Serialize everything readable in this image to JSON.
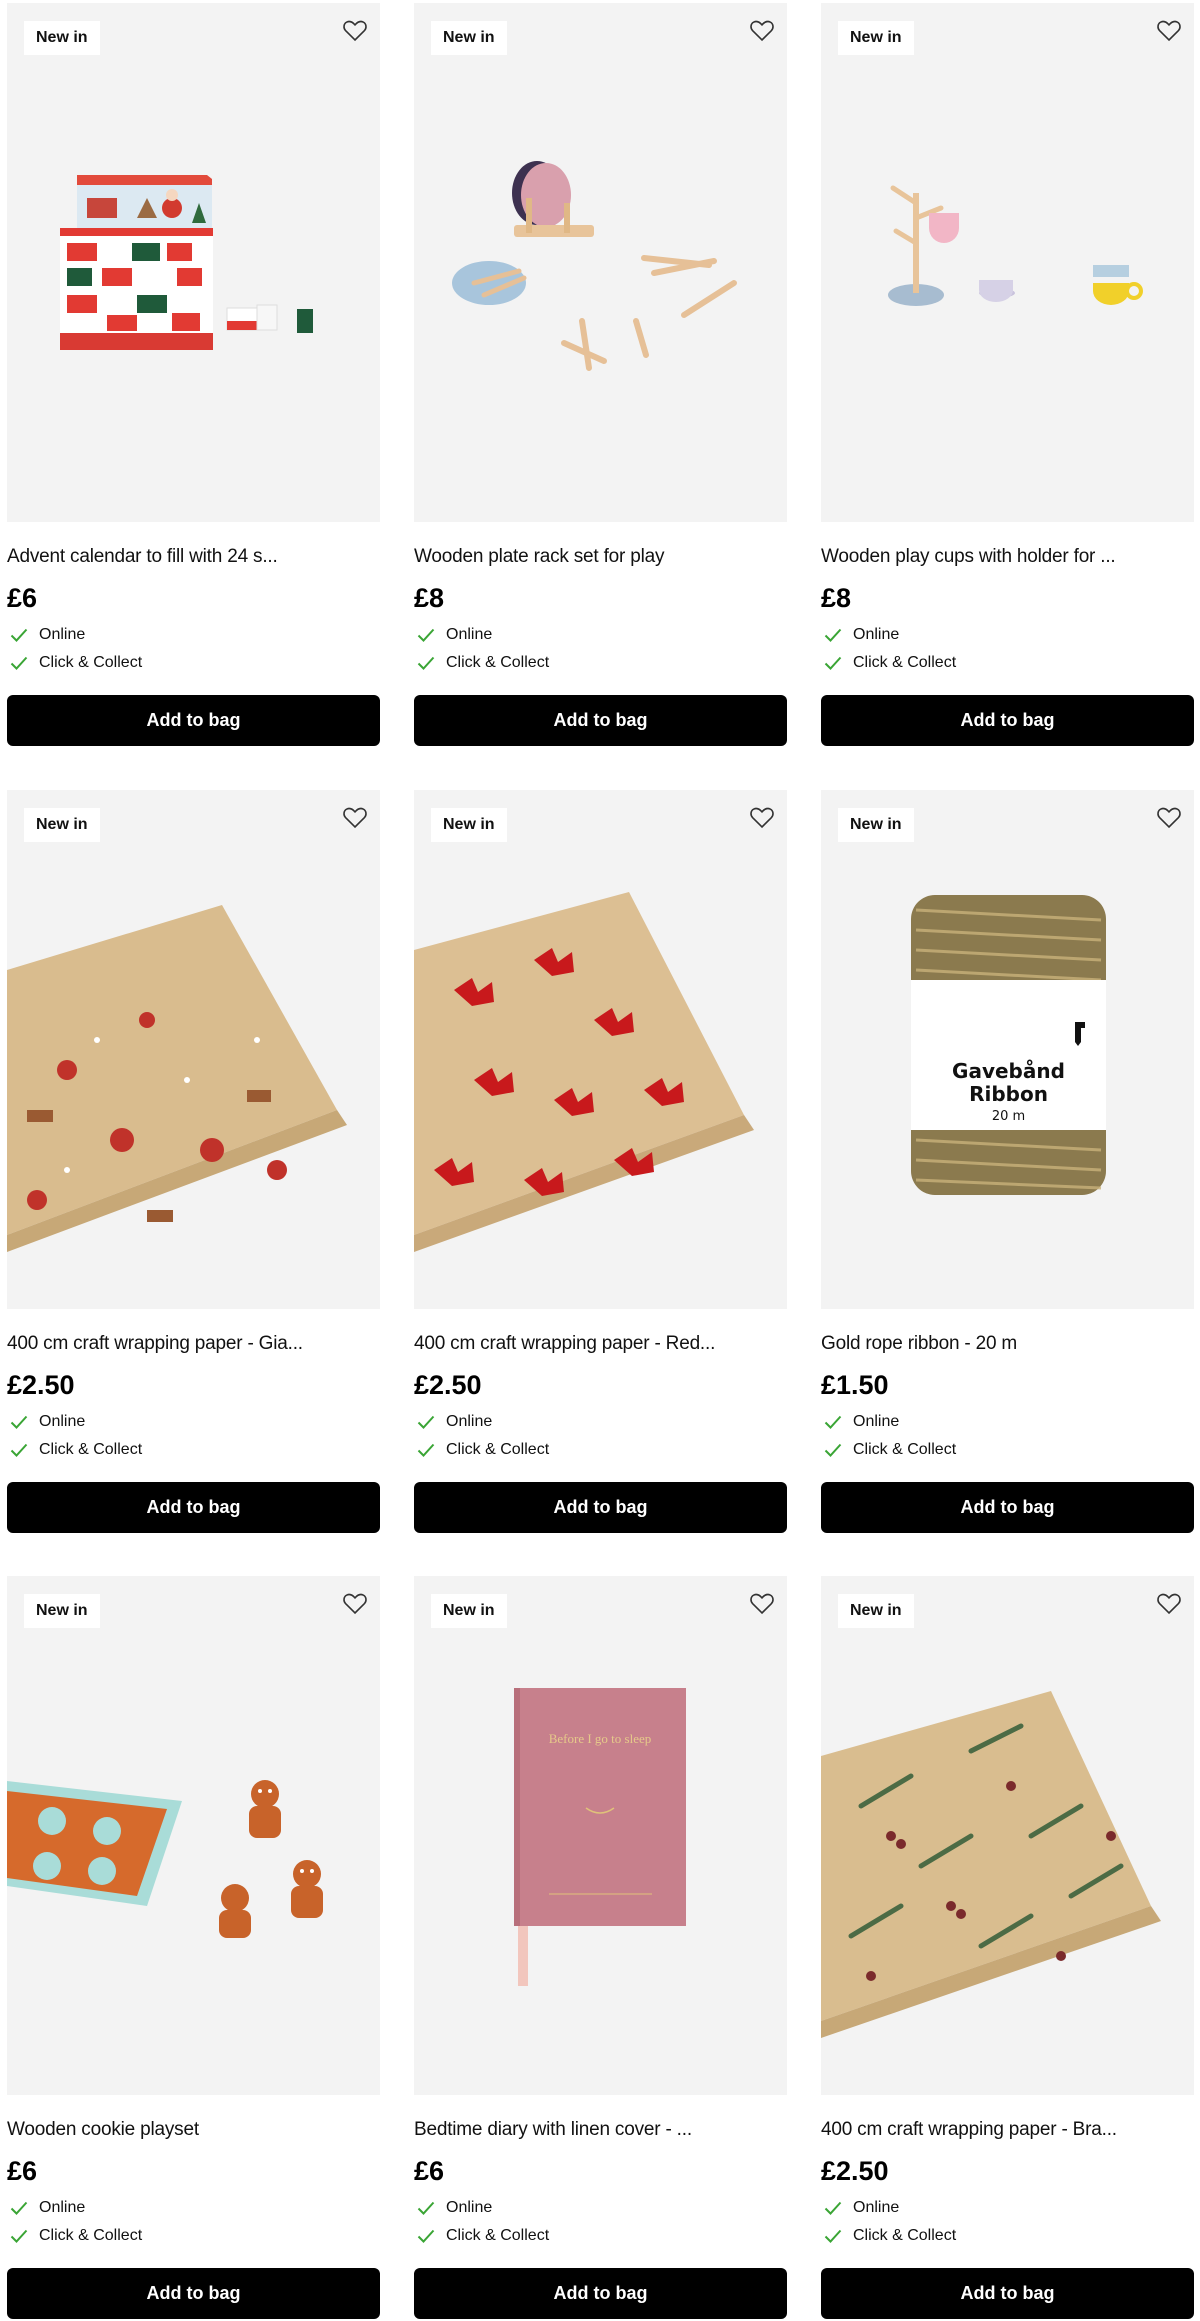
{
  "products": [
    {
      "badge": "New in",
      "title": "Advent calendar to fill with 24 s...",
      "price": "£6",
      "availability": [
        "Online",
        "Click & Collect"
      ],
      "button": "Add to bag",
      "image": "advent-calendar-box"
    },
    {
      "badge": "New in",
      "title": "Wooden plate rack set for play",
      "price": "£8",
      "availability": [
        "Online",
        "Click & Collect"
      ],
      "button": "Add to bag",
      "image": "wooden-plate-rack"
    },
    {
      "badge": "New in",
      "title": "Wooden play cups with holder for ...",
      "price": "£8",
      "availability": [
        "Online",
        "Click & Collect"
      ],
      "button": "Add to bag",
      "image": "play-cups-holder"
    },
    {
      "badge": "New in",
      "title": "400 cm craft wrapping paper - Gia...",
      "price": "£2.50",
      "availability": [
        "Online",
        "Click & Collect"
      ],
      "button": "Add to bag",
      "image": "santa-wrapping-paper"
    },
    {
      "badge": "New in",
      "title": "400 cm craft wrapping paper - Red...",
      "price": "£2.50",
      "availability": [
        "Online",
        "Click & Collect"
      ],
      "button": "Add to bag",
      "image": "red-bow-wrapping-paper"
    },
    {
      "badge": "New in",
      "title": "Gold rope ribbon - 20 m",
      "price": "£1.50",
      "availability": [
        "Online",
        "Click & Collect"
      ],
      "button": "Add to bag",
      "image": "gold-ribbon-spool",
      "label_text": [
        "Gavebånd",
        "Ribbon",
        "20 m"
      ]
    },
    {
      "badge": "New in",
      "title": "Wooden cookie playset",
      "price": "£6",
      "availability": [
        "Online",
        "Click & Collect"
      ],
      "button": "Add to bag",
      "image": "gingerbread-cookie-set"
    },
    {
      "badge": "New in",
      "title": "Bedtime diary with linen cover - ...",
      "price": "£6",
      "availability": [
        "Online",
        "Click & Collect"
      ],
      "button": "Add to bag",
      "image": "pink-linen-diary",
      "cover_text": "Before I go to sleep"
    },
    {
      "badge": "New in",
      "title": "400 cm craft wrapping paper - Bra...",
      "price": "£2.50",
      "availability": [
        "Online",
        "Click & Collect"
      ],
      "button": "Add to bag",
      "image": "botanical-wrapping-paper"
    }
  ],
  "colors": {
    "check": "#3aa535",
    "button_bg": "#000000",
    "image_bg": "#f3f3f3"
  }
}
